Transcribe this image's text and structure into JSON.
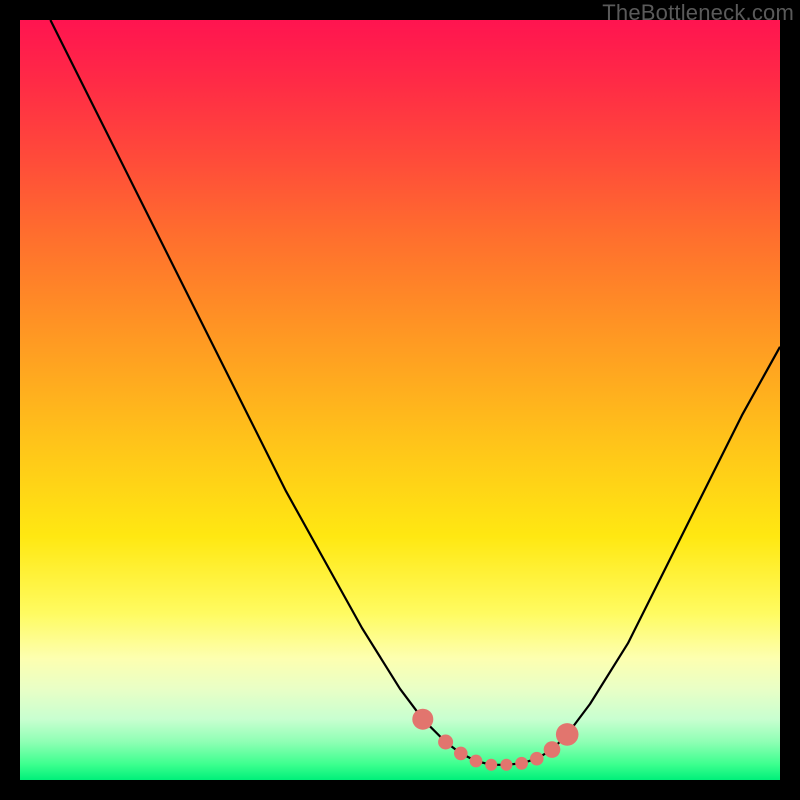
{
  "watermark": {
    "text": "TheBottleneck.com"
  },
  "colors": {
    "page_bg": "#000000",
    "curve": "#000000",
    "marker": "#e2756e"
  },
  "chart_data": {
    "type": "line",
    "title": "",
    "xlabel": "",
    "ylabel": "",
    "xlim": [
      0,
      100
    ],
    "ylim": [
      0,
      100
    ],
    "grid": false,
    "legend": null,
    "series": [
      {
        "name": "bottleneck-curve",
        "x": [
          4,
          10,
          15,
          20,
          25,
          30,
          35,
          40,
          45,
          50,
          53,
          56,
          58,
          60,
          62,
          64,
          66,
          68,
          70,
          72,
          75,
          80,
          85,
          90,
          95,
          100
        ],
        "y": [
          100,
          88,
          78,
          68,
          58,
          48,
          38,
          29,
          20,
          12,
          8,
          5,
          3.5,
          2.5,
          2,
          2,
          2.2,
          2.8,
          4,
          6,
          10,
          18,
          28,
          38,
          48,
          57
        ]
      }
    ],
    "markers": {
      "name": "highlighted-points",
      "x": [
        53,
        56,
        58,
        60,
        62,
        64,
        66,
        68,
        70,
        72
      ],
      "y": [
        8,
        5,
        3.5,
        2.5,
        2,
        2,
        2.2,
        2.8,
        4,
        6
      ],
      "radius_scale": [
        1.4,
        1.0,
        0.9,
        0.85,
        0.8,
        0.8,
        0.85,
        0.9,
        1.1,
        1.5
      ]
    }
  }
}
